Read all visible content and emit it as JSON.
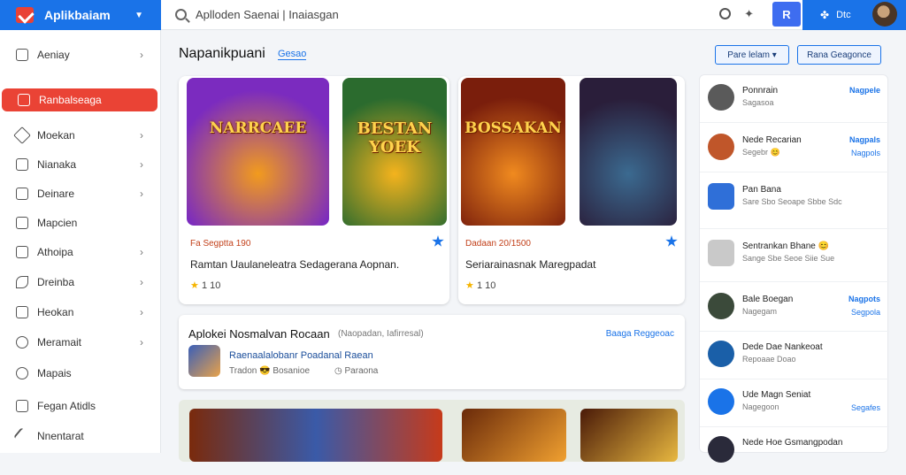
{
  "header": {
    "app_title": "Aplikbaiam",
    "search_value": "Aplloden Saenai | Inaiasgan",
    "button_label": "R",
    "account_label": "Dtc"
  },
  "sidebar": {
    "items": [
      {
        "label": "Aeniay",
        "chevron": "›"
      },
      {
        "label": "Ranbalseaga",
        "chevron": ""
      },
      {
        "label": "Moekan",
        "chevron": "›"
      },
      {
        "label": "Nianaka",
        "chevron": "›"
      },
      {
        "label": "Deinare",
        "chevron": "›"
      },
      {
        "label": "Mapcien",
        "chevron": ""
      },
      {
        "label": "Athoipa",
        "chevron": "›"
      },
      {
        "label": "Dreinba",
        "chevron": "›"
      },
      {
        "label": "Heokan",
        "chevron": "›"
      },
      {
        "label": "Meramait",
        "chevron": "›"
      },
      {
        "label": "Mapais",
        "chevron": ""
      },
      {
        "label": "Fegan Atidls",
        "chevron": ""
      },
      {
        "label": "Nnentarat",
        "chevron": ""
      }
    ]
  },
  "main": {
    "section_title": "Napanikpuani",
    "section_link": "Gesao",
    "games": [
      {
        "thumb_text": "NARRCAEE",
        "colors": [
          "#7b2bbf",
          "#f29b1d"
        ]
      },
      {
        "thumb_text": "BESTAN YOEK",
        "colors": [
          "#2b6b2e",
          "#f4b31d"
        ]
      },
      {
        "thumb_text": "BOSSAKAN",
        "colors": [
          "#7a1e0c",
          "#f08a1f"
        ]
      },
      {
        "thumb_text": "",
        "colors": [
          "#2a1e3a",
          "#3b6a90"
        ]
      }
    ],
    "card_left": {
      "price": "Fa Segptta 190",
      "title": "Ramtan Uaulaneleatra Sedagerana Aopnan.",
      "rating": "1 10"
    },
    "card_right": {
      "price": "Dadaan 20/1500",
      "title": "Seriarainasnak Maregpadat",
      "rating": "1 10"
    },
    "featured": {
      "title": "Aplokei Nosmalvan Rocaan",
      "subtitle": "(Naopadan, Iafirresal)",
      "link": "Baaga Reggeoac",
      "app_name": "Raenaalalobanr Poadanal Raean",
      "app_meta": "Tradon 😎 Bosanioe",
      "app_meta2": "Paraona"
    }
  },
  "right": {
    "btn1": "Pare lelam",
    "btn2": "Rana Geagonce",
    "items": [
      {
        "name": "Ponnrain",
        "sub": "Sagasoa",
        "r1": "Nagpele",
        "r2": "",
        "color": "#5a5a5a"
      },
      {
        "name": "Nede Recarian",
        "sub": "Segebr 😊",
        "r1": "Nagpals",
        "r2": "Nagpols",
        "color": "#c0562a"
      },
      {
        "name": "Pan Bana",
        "sub": "Sare Sbo Seoape Sbbe Sdc",
        "r1": "",
        "r2": "",
        "color": "#2f6fd8"
      },
      {
        "name": "Sentrankan Bhane 😊",
        "sub": "Sange Sbe Seoe Siie Sue",
        "r1": "",
        "r2": "",
        "color": "#c9c9c9"
      },
      {
        "name": "Bale Boegan",
        "sub": "Nagegam",
        "r1": "Nagpots",
        "r2": "Segpola",
        "color": "#3b4a3a"
      },
      {
        "name": "Dede Dae Nankeoat",
        "sub": "Repoaae Doao",
        "r1": "",
        "r2": "",
        "color": "#1a5fa8"
      },
      {
        "name": "Ude Magn Seniat",
        "sub": "Nagegoon",
        "r1": "",
        "r2": "Segafes",
        "color": "#1a73e8"
      },
      {
        "name": "Nede Hoe Gsmangpodan",
        "sub": "",
        "r1": "",
        "r2": "",
        "color": "#2a2a3a"
      }
    ]
  }
}
